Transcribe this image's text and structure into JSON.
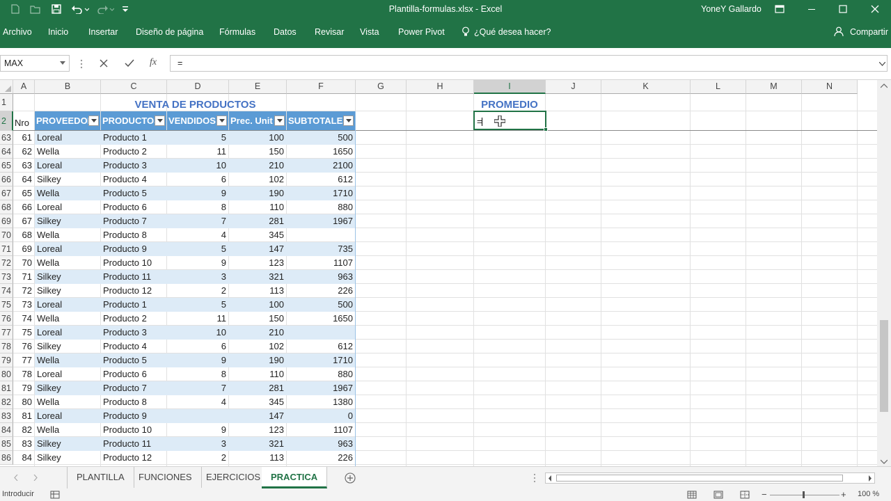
{
  "window": {
    "title": "Plantilla-formulas.xlsx  -  Excel",
    "user": "YoneY Gallardo"
  },
  "ribbon_tabs": [
    "Archivo",
    "Inicio",
    "Insertar",
    "Diseño de página",
    "Fórmulas",
    "Datos",
    "Revisar",
    "Vista",
    "Power Pivot",
    "¿Qué desea hacer?",
    "Compartir"
  ],
  "formula_bar": {
    "name_box": "MAX",
    "formula": "="
  },
  "columns": [
    "A",
    "B",
    "C",
    "D",
    "E",
    "F",
    "G",
    "H",
    "I",
    "J",
    "K",
    "L",
    "M",
    "N"
  ],
  "table_title": "VENTA DE PRODUCTOS",
  "promedio_label": "PROMEDIO",
  "active_cell_value": "=",
  "headers": [
    "Nro",
    "PROVEEDOR",
    "PRODUCTOS",
    "VENDIDOS",
    "Prec. Unit",
    "SUBTOTALES"
  ],
  "row_numbers": [
    "1",
    "2",
    "63",
    "64",
    "65",
    "66",
    "67",
    "68",
    "69",
    "70",
    "71",
    "72",
    "73",
    "74",
    "75",
    "76",
    "77",
    "78",
    "79",
    "80",
    "81",
    "82",
    "83",
    "84",
    "85",
    "86"
  ],
  "rows": [
    [
      "61",
      "Loreal",
      "Producto 1",
      "5",
      "100",
      "500"
    ],
    [
      "62",
      "Wella",
      "Producto 2",
      "11",
      "150",
      "1650"
    ],
    [
      "63",
      "Loreal",
      "Producto 3",
      "10",
      "210",
      "2100"
    ],
    [
      "64",
      "Silkey",
      "Producto 4",
      "6",
      "102",
      "612"
    ],
    [
      "65",
      "Wella",
      "Producto 5",
      "9",
      "190",
      "1710"
    ],
    [
      "66",
      "Loreal",
      "Producto 6",
      "8",
      "110",
      "880"
    ],
    [
      "67",
      "Silkey",
      "Producto 7",
      "7",
      "281",
      "1967"
    ],
    [
      "68",
      "Wella",
      "Producto 8",
      "4",
      "345",
      ""
    ],
    [
      "69",
      "Loreal",
      "Producto 9",
      "5",
      "147",
      "735"
    ],
    [
      "70",
      "Wella",
      "Producto 10",
      "9",
      "123",
      "1107"
    ],
    [
      "71",
      "Silkey",
      "Producto 11",
      "3",
      "321",
      "963"
    ],
    [
      "72",
      "Silkey",
      "Producto 12",
      "2",
      "113",
      "226"
    ],
    [
      "73",
      "Loreal",
      "Producto 1",
      "5",
      "100",
      "500"
    ],
    [
      "74",
      "Wella",
      "Producto 2",
      "11",
      "150",
      "1650"
    ],
    [
      "75",
      "Loreal",
      "Producto 3",
      "10",
      "210",
      ""
    ],
    [
      "76",
      "Silkey",
      "Producto 4",
      "6",
      "102",
      "612"
    ],
    [
      "77",
      "Wella",
      "Producto 5",
      "9",
      "190",
      "1710"
    ],
    [
      "78",
      "Loreal",
      "Producto 6",
      "8",
      "110",
      "880"
    ],
    [
      "79",
      "Silkey",
      "Producto 7",
      "7",
      "281",
      "1967"
    ],
    [
      "80",
      "Wella",
      "Producto 8",
      "4",
      "345",
      "1380"
    ],
    [
      "81",
      "Loreal",
      "Producto 9",
      "",
      "147",
      "0"
    ],
    [
      "82",
      "Wella",
      "Producto 10",
      "9",
      "123",
      "1107"
    ],
    [
      "83",
      "Silkey",
      "Producto 11",
      "3",
      "321",
      "963"
    ],
    [
      "84",
      "Silkey",
      "Producto 12",
      "2",
      "113",
      "226"
    ]
  ],
  "sheet_tabs": [
    "PLANTILLA",
    "FUNCIONES",
    "EJERCICIOS",
    "PRACTICA"
  ],
  "active_sheet": "PRACTICA",
  "status": {
    "mode": "Introducir",
    "zoom": "100 %"
  },
  "colors": {
    "excel_green": "#217346",
    "table_header": "#5b9bd5",
    "band": "#ddebf7",
    "title_blue": "#4472c4"
  }
}
